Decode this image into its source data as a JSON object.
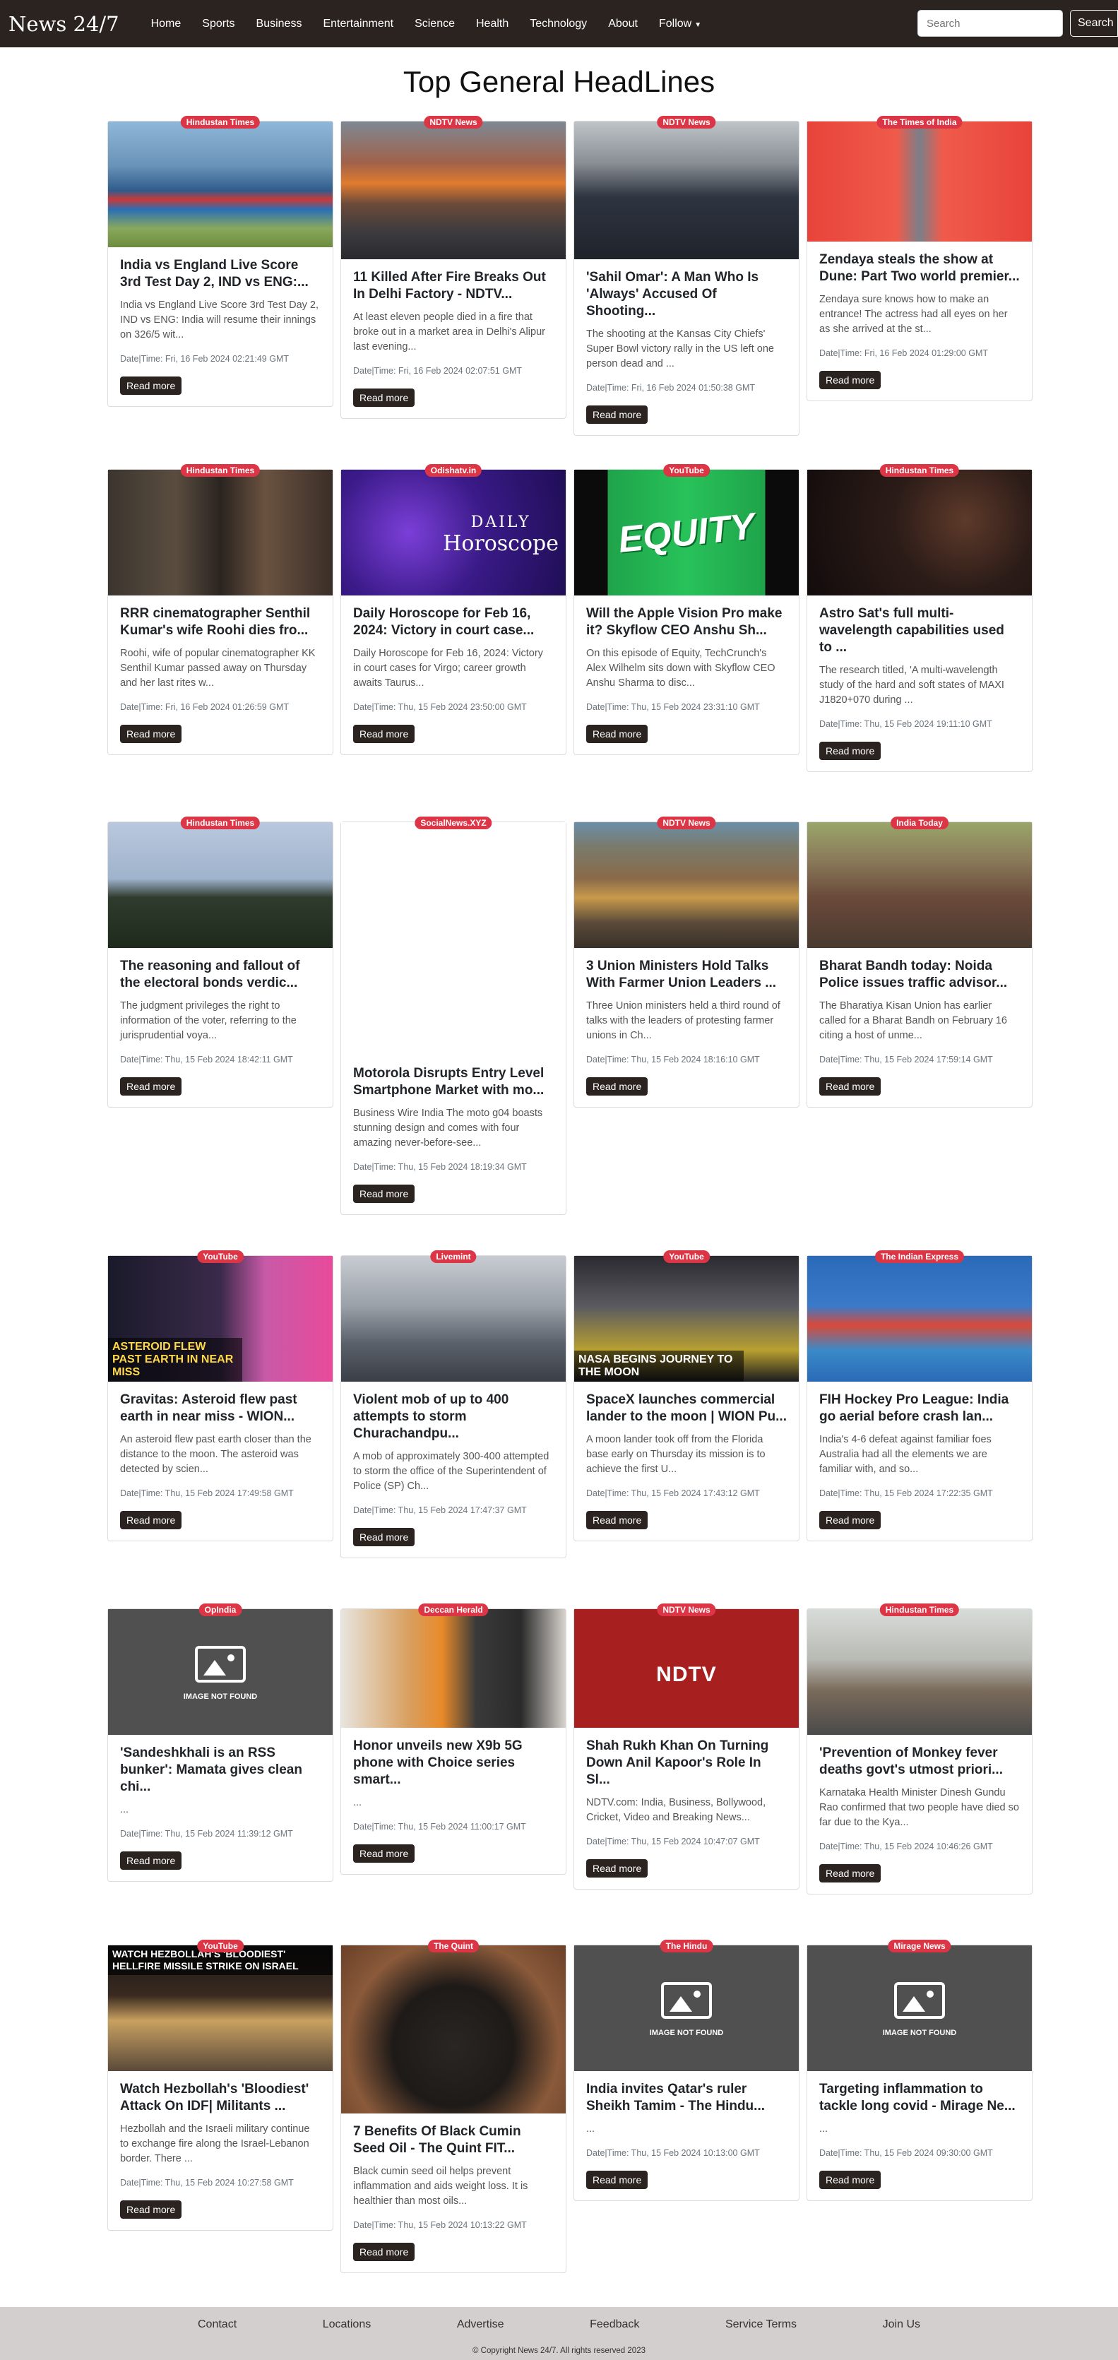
{
  "navbar": {
    "brand": "News 24/7",
    "links": [
      "Home",
      "Sports",
      "Business",
      "Entertainment",
      "Science",
      "Health",
      "Technology",
      "About"
    ],
    "follow_label": "Follow",
    "search_placeholder": "Search",
    "search_button": "Search"
  },
  "page_title": "Top General HeadLines",
  "read_more_label": "Read more",
  "articles": [
    {
      "source": "Hindustan Times",
      "title": "India vs England Live Score 3rd Test Day 2, IND vs ENG:...",
      "desc": "India vs England Live Score 3rd Test Day 2, IND vs ENG: India will resume their innings on 326/5 wit...",
      "date": "Date|Time: Fri, 16 Feb 2024 02:21:49 GMT"
    },
    {
      "source": "NDTV News",
      "title": "11 Killed After Fire Breaks Out In Delhi Factory - NDTV...",
      "desc": "At least eleven people died in a fire that broke out in a market area in Delhi's Alipur last evening...",
      "date": "Date|Time: Fri, 16 Feb 2024 02:07:51 GMT"
    },
    {
      "source": "NDTV News",
      "title": "'Sahil Omar': A Man Who Is 'Always' Accused Of Shooting...",
      "desc": "The shooting at the Kansas City Chiefs' Super Bowl victory rally in the US left one person dead and ...",
      "date": "Date|Time: Fri, 16 Feb 2024 01:50:38 GMT"
    },
    {
      "source": "The Times of India",
      "title": "Zendaya steals the show at Dune: Part Two world premier...",
      "desc": "Zendaya sure knows how to make an entrance! The actress had all eyes on her as she arrived at the st...",
      "date": "Date|Time: Fri, 16 Feb 2024 01:29:00 GMT"
    },
    {
      "source": "Hindustan Times",
      "title": "RRR cinematographer Senthil Kumar's wife Roohi dies fro...",
      "desc": "Roohi, wife of popular cinematographer KK Senthil Kumar passed away on Thursday and her last rites w...",
      "date": "Date|Time: Fri, 16 Feb 2024 01:26:59 GMT"
    },
    {
      "source": "Odishatv.in",
      "title": "Daily Horoscope for Feb 16, 2024: Victory in court case...",
      "desc": "Daily Horoscope for Feb 16, 2024: Victory in court cases for Virgo; career growth awaits Taurus...",
      "date": "Date|Time: Thu, 15 Feb 2024 23:50:00 GMT"
    },
    {
      "source": "YouTube",
      "title": "Will the Apple Vision Pro make it? Skyflow CEO Anshu Sh...",
      "desc": "On this episode of Equity, TechCrunch's Alex Wilhelm sits down with Skyflow CEO Anshu Sharma to disc...",
      "date": "Date|Time: Thu, 15 Feb 2024 23:31:10 GMT"
    },
    {
      "source": "Hindustan Times",
      "title": "Astro Sat's full multi-wavelength capabilities used to ...",
      "desc": "The research titled, 'A multi-wavelength study of the hard and soft states of MAXI J1820+070 during ...",
      "date": "Date|Time: Thu, 15 Feb 2024 19:11:10 GMT"
    },
    {
      "source": "Hindustan Times",
      "title": "The reasoning and fallout of the electoral bonds verdic...",
      "desc": "The judgment privileges the right to information of the voter, referring to the jurisprudential voya...",
      "date": "Date|Time: Thu, 15 Feb 2024 18:42:11 GMT"
    },
    {
      "source": "SocialNews.XYZ",
      "title": "Motorola Disrupts Entry Level Smartphone Market with mo...",
      "desc": "Business Wire India The moto g04 boasts stunning design and comes with four amazing never-before-see...",
      "date": "Date|Time: Thu, 15 Feb 2024 18:19:34 GMT"
    },
    {
      "source": "NDTV News",
      "title": "3 Union Ministers Hold Talks With Farmer Union Leaders ...",
      "desc": "Three Union ministers held a third round of talks with the leaders of protesting farmer unions in Ch...",
      "date": "Date|Time: Thu, 15 Feb 2024 18:16:10 GMT"
    },
    {
      "source": "India Today",
      "title": "Bharat Bandh today: Noida Police issues traffic advisor...",
      "desc": "The Bharatiya Kisan Union has earlier called for a Bharat Bandh on February 16 citing a host of unme...",
      "date": "Date|Time: Thu, 15 Feb 2024 17:59:14 GMT"
    },
    {
      "source": "YouTube",
      "title": "Gravitas: Asteroid flew past earth in near miss - WION...",
      "desc": "An asteroid flew past earth closer than the distance to the moon. The asteroid was detected by scien...",
      "date": "Date|Time: Thu, 15 Feb 2024 17:49:58 GMT"
    },
    {
      "source": "Livemint",
      "title": "Violent mob of up to 400 attempts to storm Churachandpu...",
      "desc": "A mob of approximately 300-400 attempted to storm the office of the Superintendent of Police (SP) Ch...",
      "date": "Date|Time: Thu, 15 Feb 2024 17:47:37 GMT"
    },
    {
      "source": "YouTube",
      "title": "SpaceX launches commercial lander to the moon | WION Pu...",
      "desc": "A moon lander took off from the Florida base early on Thursday its mission is to achieve the first U...",
      "date": "Date|Time: Thu, 15 Feb 2024 17:43:12 GMT"
    },
    {
      "source": "The Indian Express",
      "title": "FIH Hockey Pro League: India go aerial before crash lan...",
      "desc": "India's 4-6 defeat against familiar foes Australia had all the elements we are familiar with, and so...",
      "date": "Date|Time: Thu, 15 Feb 2024 17:22:35 GMT"
    },
    {
      "source": "OpIndia",
      "title": "'Sandeshkhali is an RSS bunker': Mamata gives clean chi...",
      "desc": "...",
      "date": "Date|Time: Thu, 15 Feb 2024 11:39:12 GMT"
    },
    {
      "source": "Deccan Herald",
      "title": "Honor unveils new X9b 5G phone with Choice series smart...",
      "desc": "...",
      "date": "Date|Time: Thu, 15 Feb 2024 11:00:17 GMT"
    },
    {
      "source": "NDTV News",
      "title": "Shah Rukh Khan On Turning Down Anil Kapoor's Role In Sl...",
      "desc": "NDTV.com: India, Business, Bollywood, Cricket, Video and Breaking News...",
      "date": "Date|Time: Thu, 15 Feb 2024 10:47:07 GMT"
    },
    {
      "source": "Hindustan Times",
      "title": "'Prevention of Monkey fever deaths govt's utmost priori...",
      "desc": "Karnataka Health Minister Dinesh Gundu Rao confirmed that two people have died so far due to the Kya...",
      "date": "Date|Time: Thu, 15 Feb 2024 10:46:26 GMT"
    },
    {
      "source": "YouTube",
      "title": "Watch Hezbollah's 'Bloodiest' Attack On IDF| Militants ...",
      "desc": "Hezbollah and the Israeli military continue to exchange fire along the Israel-Lebanon border. There ...",
      "date": "Date|Time: Thu, 15 Feb 2024 10:27:58 GMT"
    },
    {
      "source": "The Quint",
      "title": "7 Benefits Of Black Cumin Seed Oil - The Quint FIT...",
      "desc": "Black cumin seed oil helps prevent inflammation and aids weight loss. It is healthier than most oils...",
      "date": "Date|Time: Thu, 15 Feb 2024 10:13:22 GMT"
    },
    {
      "source": "The Hindu",
      "title": "India invites Qatar's ruler Sheikh Tamim - The Hindu...",
      "desc": "...",
      "date": "Date|Time: Thu, 15 Feb 2024 10:13:00 GMT"
    },
    {
      "source": "Mirage News",
      "title": "Targeting inflammation to tackle long covid - Mirage Ne...",
      "desc": "...",
      "date": "Date|Time: Thu, 15 Feb 2024 09:30:00 GMT"
    }
  ],
  "image_text": {
    "horoscope_line1": "DAILY",
    "horoscope_line2": "Horoscope",
    "equity": "EQUITY",
    "asteroid": "ASTEROID FLEW PAST EARTH IN NEAR MISS",
    "nasa": "NASA BEGINS JOURNEY TO THE MOON",
    "hezbollah": "WATCH HEZBOLLAH'S 'BLOODIEST' HELLFIRE MISSILE STRIKE ON ISRAEL",
    "ndtv_logo": "NDTV",
    "not_found": "IMAGE NOT FOUND"
  },
  "footer": {
    "links": [
      "Contact",
      "Locations",
      "Advertise",
      "Feedback",
      "Service Terms",
      "Join Us"
    ],
    "copyright": "© Copyright News 24/7. All rights reserved 2023"
  },
  "colors": {
    "navbar_bg": "#2b2320",
    "badge_bg": "#dc3545",
    "button_bg": "#2b2320",
    "footer_bg": "#d3cfcf"
  }
}
